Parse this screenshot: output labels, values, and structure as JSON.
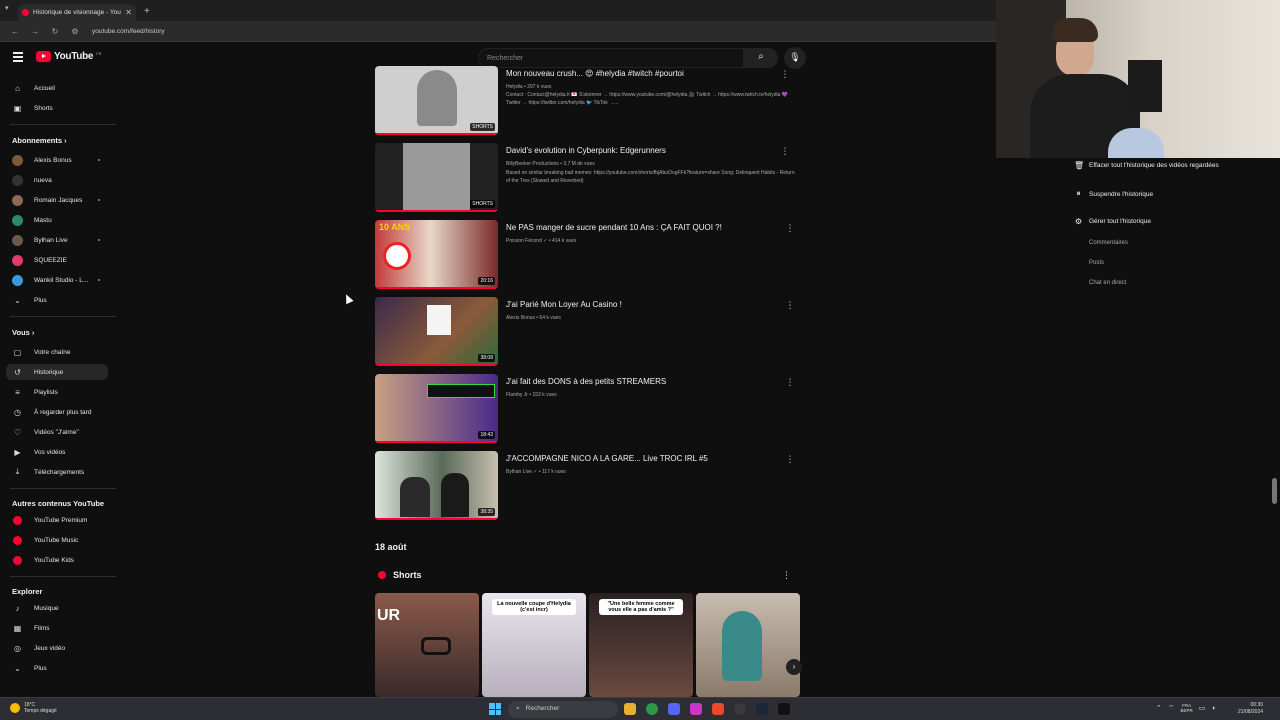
{
  "browser": {
    "tab_title": "Historique de visionnage - YouTu",
    "url": "youtube.com/feed/history"
  },
  "header": {
    "logo_text": "YouTube",
    "logo_country": "FR",
    "search_placeholder": "Rechercher"
  },
  "sidebar": {
    "main": [
      {
        "label": "Accueil",
        "icon": "home-icon"
      },
      {
        "label": "Shorts",
        "icon": "shorts-icon"
      }
    ],
    "subscriptions_title": "Abonnements",
    "subscriptions": [
      {
        "label": "Alexis Bonus",
        "color": "#7a5a3a",
        "new": true
      },
      {
        "label": "nueva",
        "color": "#333333",
        "new": false
      },
      {
        "label": "Romain Jacques",
        "color": "#8a6a55",
        "new": true
      },
      {
        "label": "Mastu",
        "color": "#2a8a6a",
        "new": false
      },
      {
        "label": "Bylhan Live",
        "color": "#6a5a4a",
        "new": true
      },
      {
        "label": "SQUEEZIE",
        "color": "#e23a6a",
        "new": false
      },
      {
        "label": "Wankil Studio - L...",
        "color": "#3a9ad9",
        "new": true
      }
    ],
    "subscriptions_more": "Plus",
    "you_title": "Vous",
    "you": [
      {
        "label": "Votre chaîne",
        "icon": "channel-icon"
      },
      {
        "label": "Historique",
        "icon": "history-icon",
        "active": true
      },
      {
        "label": "Playlists",
        "icon": "playlist-icon"
      },
      {
        "label": "À regarder plus tard",
        "icon": "watch-later-icon"
      },
      {
        "label": "Vidéos \"J'aime\"",
        "icon": "like-icon"
      },
      {
        "label": "Vos vidéos",
        "icon": "your-videos-icon"
      },
      {
        "label": "Téléchargements",
        "icon": "download-icon"
      }
    ],
    "other_title": "Autres contenus YouTube",
    "other": [
      {
        "label": "YouTube Premium"
      },
      {
        "label": "YouTube Music"
      },
      {
        "label": "YouTube Kids"
      }
    ],
    "explore_title": "Explorer",
    "explore": [
      {
        "label": "Musique",
        "icon": "music-icon"
      },
      {
        "label": "Films",
        "icon": "film-icon"
      },
      {
        "label": "Jeux vidéo",
        "icon": "gaming-icon"
      },
      {
        "label": "Plus",
        "icon": "chevron-down-icon"
      }
    ]
  },
  "videos": [
    {
      "title": "Mon nouveau crush... 😍 #helydia #twitch #pourtoi",
      "meta": "Helydia • 297 k vues",
      "desc": "Contact : Contact@helydia.fr 💌 S'abonner → https://www.youtube.com/@helydia 🎥 Twitch → https://www.twitch.tv/helydia 💜 Twitter → https://twitter.com/helydia 🐦 TikTok →...",
      "badge": "SHORTS",
      "thumb": "#cfcfcf"
    },
    {
      "title": "David's evolution in Cyberpunk: Edgerunners",
      "meta": "BillyBeeker Productions • 3,7 M de vues",
      "desc": "Based on similar breaking bad memes: https://youtube.com/shorts/fbjAbuOogFFk?feature=share Song: Delinquent Habits - Return of the Tres (Slowed and Reverbed)",
      "badge": "SHORTS",
      "thumb": "#9a9a9a"
    },
    {
      "title": "Ne PAS manger de sucre pendant 10 Ans : ÇA FAIT QUOI ?!",
      "meta": "Poisson Fécond ✓ • 414 k vues",
      "desc": "",
      "badge": "20:16",
      "thumb": "#8b2d2d"
    },
    {
      "title": "J'ai Parié Mon Loyer Au Casino !",
      "meta": "Alexis Bonus • 64 k vues",
      "desc": "",
      "badge": "38:08",
      "thumb": "#5a3a4a"
    },
    {
      "title": "J'ai fait des DONS à des petits STREAMERS",
      "meta": "Flamby Jr • 153 k vues",
      "desc": "",
      "badge": "18:43",
      "thumb": "#4a2a6a"
    },
    {
      "title": "J'ACCOMPAGNE NICO A LA GARE... Live TROC IRL #5",
      "meta": "Bylhan Live ✓ • 117 k vues",
      "desc": "",
      "badge": "38:35",
      "thumb": "#3a4a3a"
    }
  ],
  "date_heading": "18 août",
  "shorts": {
    "title": "Shorts",
    "cards": [
      {
        "caption": "",
        "overlay": "UR",
        "color": "#6a4a3a"
      },
      {
        "caption": "La nouvelle coupe d'Helydia (c'est incr)",
        "overlay": "",
        "color": "#d8d0d8"
      },
      {
        "caption": "\"Une belle femme comme vous elle a pas d'amis ?\"",
        "overlay": "",
        "color": "#4a3a3a"
      },
      {
        "caption": "",
        "overlay": "",
        "color": "#b8a898"
      }
    ]
  },
  "right_panel": {
    "actions": [
      {
        "label": "Effacer tout l'historique des vidéos regardées",
        "icon": "trash-icon"
      },
      {
        "label": "Suspendre l'historique",
        "icon": "pause-icon"
      },
      {
        "label": "Gérer tout l'historique",
        "icon": "gear-icon"
      }
    ],
    "sub": [
      "Commentaires",
      "Posts",
      "Chat en direct"
    ]
  },
  "taskbar": {
    "weather_temp": "18°C",
    "weather_desc": "Temps dégagé",
    "search": "Rechercher",
    "lang1": "FRA",
    "lang2": "BEPR",
    "time": "00:30",
    "date": "21/08/2024"
  }
}
